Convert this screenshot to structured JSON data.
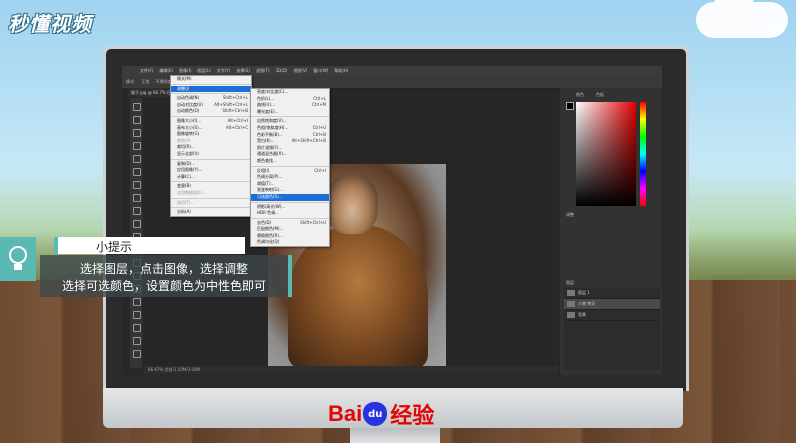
{
  "watermark": {
    "brand": "秒懂视频"
  },
  "ps": {
    "logo": "Ps",
    "menubar": [
      "文件(F)",
      "编辑(E)",
      "图像(I)",
      "图层(L)",
      "文字(Y)",
      "选择(S)",
      "滤镜(T)",
      "3D(D)",
      "视图(V)",
      "窗口(W)",
      "帮助(H)"
    ],
    "options": [
      "模式:",
      "正常",
      "不透明度: 100%",
      "流量: 100%"
    ],
    "doc_tab": "猴子.jpg @ 66.7% (图层 1, RGB/8)",
    "status": "66.67%    文档:1.10M/3.50M",
    "panels": {
      "color": "颜色",
      "swatches": "色板",
      "adjust": "调整",
      "layers": "图层"
    },
    "layers": [
      "图层 1",
      "人物 拷贝",
      "背景"
    ],
    "image_menu": [
      {
        "label": "模式(M)",
        "sc": "",
        "type": "item"
      },
      {
        "label": "",
        "type": "sep"
      },
      {
        "label": "调整(J)",
        "sc": "",
        "type": "hl"
      },
      {
        "label": "",
        "type": "sep"
      },
      {
        "label": "自动色调(N)",
        "sc": "Shift+Ctrl+L",
        "type": "item"
      },
      {
        "label": "自动对比度(U)",
        "sc": "Alt+Shift+Ctrl+L",
        "type": "item"
      },
      {
        "label": "自动颜色(O)",
        "sc": "Shift+Ctrl+B",
        "type": "item"
      },
      {
        "label": "",
        "type": "sep"
      },
      {
        "label": "图像大小(I)...",
        "sc": "Alt+Ctrl+I",
        "type": "item"
      },
      {
        "label": "画布大小(S)...",
        "sc": "Alt+Ctrl+C",
        "type": "item"
      },
      {
        "label": "图像旋转(G)",
        "sc": "",
        "type": "item"
      },
      {
        "label": "裁剪(P)",
        "sc": "",
        "type": "dim"
      },
      {
        "label": "裁切(R)...",
        "sc": "",
        "type": "item"
      },
      {
        "label": "显示全部(V)",
        "sc": "",
        "type": "item"
      },
      {
        "label": "",
        "type": "sep"
      },
      {
        "label": "复制(D)...",
        "sc": "",
        "type": "item"
      },
      {
        "label": "应用图像(Y)...",
        "sc": "",
        "type": "item"
      },
      {
        "label": "计算(C)...",
        "sc": "",
        "type": "item"
      },
      {
        "label": "",
        "type": "sep"
      },
      {
        "label": "变量(B)",
        "sc": "",
        "type": "item"
      },
      {
        "label": "应用数据组(L)...",
        "sc": "",
        "type": "dim"
      },
      {
        "label": "",
        "type": "sep"
      },
      {
        "label": "陷印(T)...",
        "sc": "",
        "type": "dim"
      },
      {
        "label": "",
        "type": "sep"
      },
      {
        "label": "分析(A)",
        "sc": "",
        "type": "item"
      }
    ],
    "adjust_menu": [
      {
        "label": "亮度/对比度(C)...",
        "sc": "",
        "type": "item"
      },
      {
        "label": "色阶(L)...",
        "sc": "Ctrl+L",
        "type": "item"
      },
      {
        "label": "曲线(U)...",
        "sc": "Ctrl+M",
        "type": "item"
      },
      {
        "label": "曝光度(E)...",
        "sc": "",
        "type": "item"
      },
      {
        "label": "",
        "type": "sep"
      },
      {
        "label": "自然饱和度(V)...",
        "sc": "",
        "type": "item"
      },
      {
        "label": "色相/饱和度(H)...",
        "sc": "Ctrl+U",
        "type": "item"
      },
      {
        "label": "色彩平衡(B)...",
        "sc": "Ctrl+B",
        "type": "item"
      },
      {
        "label": "黑白(K)...",
        "sc": "Alt+Shift+Ctrl+B",
        "type": "item"
      },
      {
        "label": "照片滤镜(F)...",
        "sc": "",
        "type": "item"
      },
      {
        "label": "通道混合器(X)...",
        "sc": "",
        "type": "item"
      },
      {
        "label": "颜色查找...",
        "sc": "",
        "type": "item"
      },
      {
        "label": "",
        "type": "sep"
      },
      {
        "label": "反相(I)",
        "sc": "Ctrl+I",
        "type": "item"
      },
      {
        "label": "色调分离(P)...",
        "sc": "",
        "type": "item"
      },
      {
        "label": "阈值(T)...",
        "sc": "",
        "type": "item"
      },
      {
        "label": "渐变映射(G)...",
        "sc": "",
        "type": "item"
      },
      {
        "label": "可选颜色(S)...",
        "sc": "",
        "type": "hl"
      },
      {
        "label": "",
        "type": "sep"
      },
      {
        "label": "阴影/高光(W)...",
        "sc": "",
        "type": "item"
      },
      {
        "label": "HDR 色调...",
        "sc": "",
        "type": "item"
      },
      {
        "label": "",
        "type": "sep"
      },
      {
        "label": "去色(D)",
        "sc": "Shift+Ctrl+U",
        "type": "item"
      },
      {
        "label": "匹配颜色(M)...",
        "sc": "",
        "type": "item"
      },
      {
        "label": "替换颜色(R)...",
        "sc": "",
        "type": "item"
      },
      {
        "label": "色调均化(Q)",
        "sc": "",
        "type": "item"
      }
    ]
  },
  "tip": {
    "title": "小提示",
    "line1": "选择图层，点击图像，选择调整",
    "line2": "选择可选颜色，设置颜色为中性色即可"
  },
  "brand": {
    "bai": "Bai",
    "du": "du",
    "jy": "经验"
  }
}
